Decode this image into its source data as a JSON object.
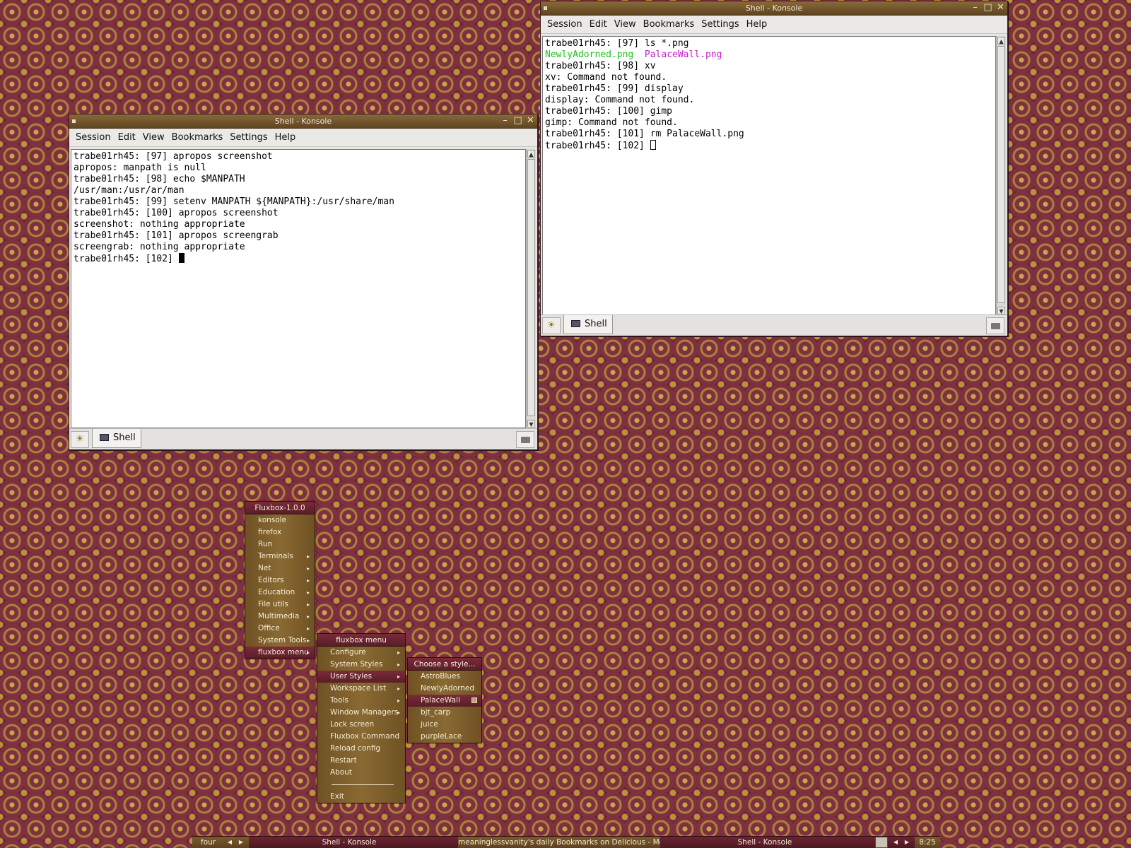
{
  "colors": {
    "desktop_bg": "#6e2a36",
    "menu_gold": "#8a6a33",
    "menu_highlight": "#5a1d28",
    "ls_file_green": "#22c022",
    "ls_file_magenta": "#c020c0"
  },
  "window_left": {
    "title": "Shell - Konsole",
    "menu": [
      "Session",
      "Edit",
      "View",
      "Bookmarks",
      "Settings",
      "Help"
    ],
    "lines": [
      "trabe01rh45: [97] apropos screenshot",
      "apropos: manpath is null",
      "trabe01rh45: [98] echo $MANPATH",
      "/usr/man:/usr/ar/man",
      "trabe01rh45: [99] setenv MANPATH ${MANPATH}:/usr/share/man",
      "trabe01rh45: [100] apropos screenshot",
      "screenshot: nothing appropriate",
      "trabe01rh45: [101] apropos screengrab",
      "screengrab: nothing appropriate"
    ],
    "prompt": "trabe01rh45: [102] ",
    "tab_label": "Shell"
  },
  "window_right": {
    "title": "Shell - Konsole",
    "menu": [
      "Session",
      "Edit",
      "View",
      "Bookmarks",
      "Settings",
      "Help"
    ],
    "line_ls": "trabe01rh45: [97] ls *.png",
    "file_green": "NewlyAdorned.png",
    "file_magenta": "PalaceWall.png",
    "lines": [
      "trabe01rh45: [98] xv",
      "xv: Command not found.",
      "trabe01rh45: [99] display",
      "display: Command not found.",
      "trabe01rh45: [100] gimp",
      "gimp: Command not found.",
      "trabe01rh45: [101] rm PalaceWall.png"
    ],
    "prompt": "trabe01rh45: [102] ",
    "tab_label": "Shell"
  },
  "root_menu": {
    "title": "Fluxbox-1.0.0",
    "items": [
      {
        "label": "konsole",
        "sub": false
      },
      {
        "label": "firefox",
        "sub": false
      },
      {
        "label": "Run",
        "sub": false
      },
      {
        "label": "Terminals",
        "sub": true
      },
      {
        "label": "Net",
        "sub": true
      },
      {
        "label": "Editors",
        "sub": true
      },
      {
        "label": "Education",
        "sub": true
      },
      {
        "label": "File utils",
        "sub": true
      },
      {
        "label": "Multimedia",
        "sub": true
      },
      {
        "label": "Office",
        "sub": true
      },
      {
        "label": "System Tools",
        "sub": true
      },
      {
        "label": "fluxbox menu",
        "sub": true
      }
    ]
  },
  "fluxbox_menu": {
    "title": "fluxbox menu",
    "items": [
      {
        "label": "Configure",
        "sub": true
      },
      {
        "label": "System Styles",
        "sub": true
      },
      {
        "label": "User Styles",
        "sub": true
      },
      {
        "label": "Workspace List",
        "sub": true
      },
      {
        "label": "Tools",
        "sub": true
      },
      {
        "label": "Window Managers",
        "sub": true
      },
      {
        "label": "Lock screen",
        "sub": false
      },
      {
        "label": "Fluxbox Command",
        "sub": false
      },
      {
        "label": "Reload config",
        "sub": false
      },
      {
        "label": "Restart",
        "sub": false
      },
      {
        "label": "About",
        "sub": false
      },
      {
        "label": "",
        "sub": false
      },
      {
        "label": "Exit",
        "sub": false
      }
    ]
  },
  "styles_menu": {
    "title": "Choose a style...",
    "items": [
      "AstroBlues",
      "NewlyAdorned",
      "PalaceWall",
      "bjt_carp",
      "juice",
      "purpleLace"
    ],
    "selected": "PalaceWall"
  },
  "toolbar": {
    "workspace": "four",
    "tasks": [
      "Shell - Konsole",
      "meaninglessvanity's daily Bookmarks on Delicious - Mozilla",
      "Shell - Konsole"
    ],
    "clock": "8:25"
  }
}
